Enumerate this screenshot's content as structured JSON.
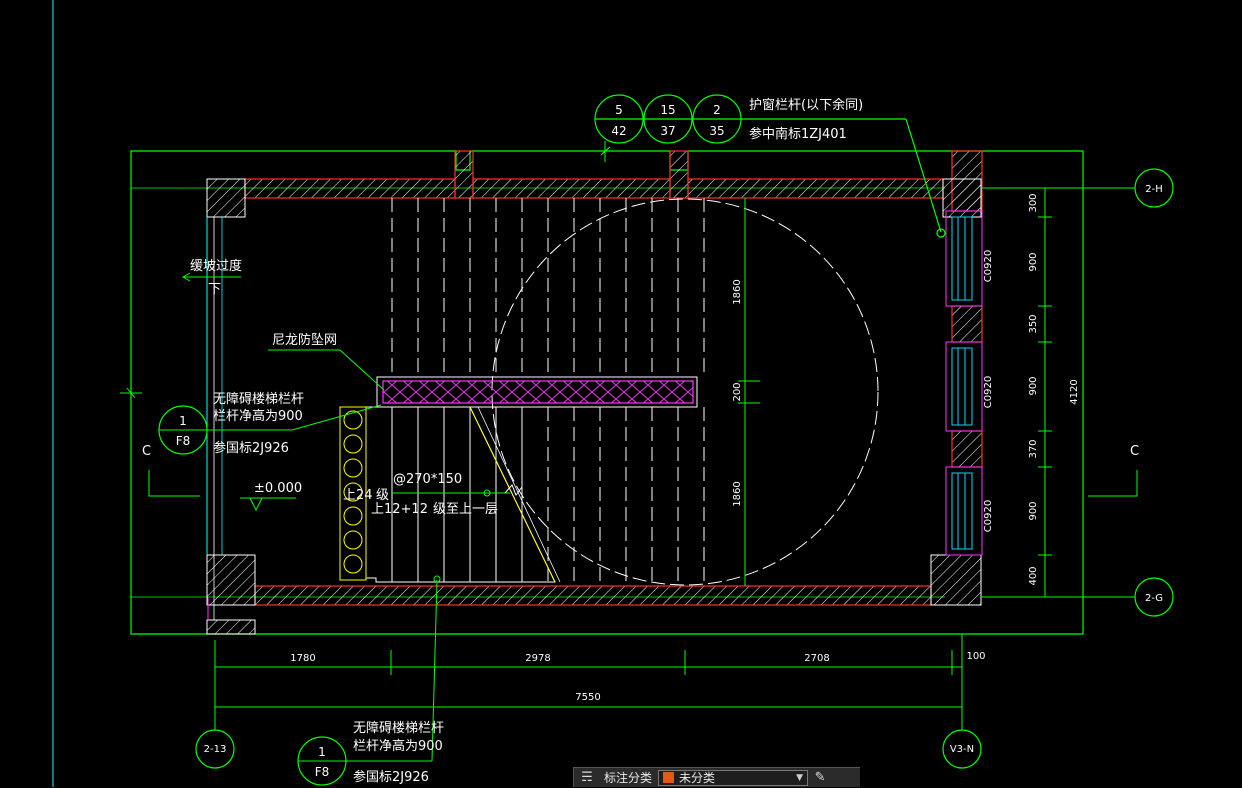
{
  "colors": {
    "background": "#000000",
    "frame": "#00ff00",
    "wall": "#ff3030",
    "hatch": "#ffffff",
    "railing_net": "#ff33ff",
    "window": "#00d8ff",
    "column_circle": "#ffff00",
    "axis_line": "#00ffff"
  },
  "axes": {
    "h_top": "2-H",
    "h_bottom": "2-G",
    "v_left": "2-13",
    "v_right": "V3-N"
  },
  "section_marks": {
    "left": "C",
    "right": "C"
  },
  "window_callout": {
    "bubbles": [
      {
        "top": "5",
        "bottom": "42"
      },
      {
        "top": "15",
        "bottom": "37"
      },
      {
        "top": "2",
        "bottom": "35"
      }
    ],
    "line1": "护窗栏杆(以下余同)",
    "line2": "参中南标1ZJ401"
  },
  "ramp_label": {
    "line1": "缓坡过度",
    "line2": "下"
  },
  "net_label": "尼龙防坠网",
  "railing_callout_left": {
    "line1": "无障碍楼梯栏杆",
    "line2": "栏杆净高为900",
    "bubble_top": "1",
    "bubble_bottom": "F8",
    "ref": "参国标2J926"
  },
  "railing_callout_bottom": {
    "line1": "无障碍楼梯栏杆",
    "line2": "栏杆净高为900",
    "bubble_top": "1",
    "bubble_bottom": "F8",
    "ref": "参国标2J926"
  },
  "elevation": "±0.000",
  "stair_notes": {
    "step": "@270*150",
    "up_count": "上24",
    "up_unit": "级",
    "split": "上12+12",
    "to_next": "级至上一层"
  },
  "dims": {
    "bottom_segments": [
      "1780",
      "2978",
      "2708"
    ],
    "bottom_extra": "100",
    "bottom_total": "7550",
    "right_segments": [
      "300",
      "900",
      "350",
      "900",
      "370",
      "900",
      "400"
    ],
    "right_total": "4120",
    "windows": [
      "C0920",
      "C0920",
      "C0920"
    ],
    "stair_vertical": [
      "1860",
      "200",
      "1860"
    ]
  },
  "toolbar": {
    "icon": "tag-icon",
    "label": "标注分类",
    "swatch_color": "#e05a12",
    "value": "未分类",
    "edit_icon": "edit-icon"
  }
}
